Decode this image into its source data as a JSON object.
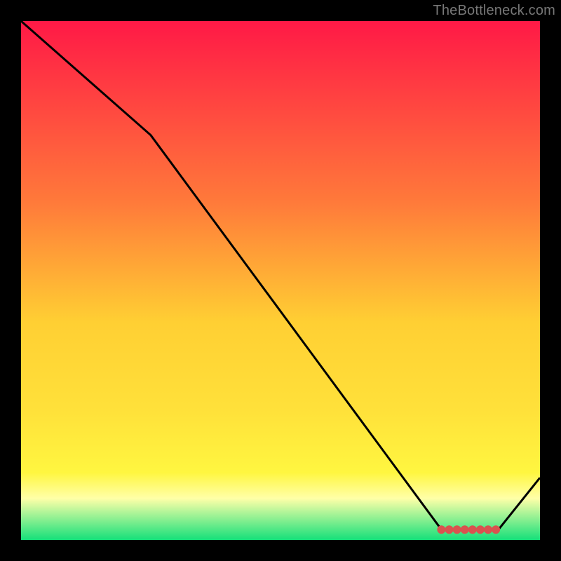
{
  "attribution": "TheBottleneck.com",
  "colors": {
    "frame": "#000000",
    "line": "#000000",
    "marker": "#d9534f",
    "grad_top": "#ff1946",
    "grad_mid1": "#ff7a3a",
    "grad_mid2": "#ffcf33",
    "grad_mid3": "#ffe13a",
    "grad_mid4": "#fff640",
    "grad_band": "#ffffa8",
    "grad_bottom": "#15e07a"
  },
  "chart_data": {
    "type": "line",
    "title": "",
    "xlabel": "",
    "ylabel": "",
    "xlim": [
      0,
      100
    ],
    "ylim": [
      0,
      100
    ],
    "series": [
      {
        "name": "curve",
        "x": [
          0,
          25,
          81,
          92,
          100
        ],
        "y": [
          100,
          78,
          2,
          2,
          12
        ]
      }
    ],
    "markers": {
      "x": [
        81,
        82.5,
        84,
        85.5,
        87,
        88.5,
        90,
        91.5
      ],
      "y": [
        2,
        2,
        2,
        2,
        2,
        2,
        2,
        2
      ]
    }
  }
}
